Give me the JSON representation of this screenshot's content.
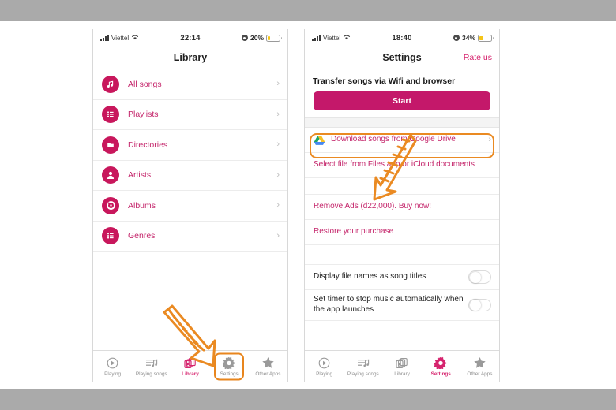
{
  "page": {
    "background_color": "#ffffff",
    "band_color": "#aaaaaa",
    "brand_pink": "#c4186a",
    "link_pink": "#c4246a",
    "accent_orange": "#e8861e",
    "battery_yellow": "#f5c518"
  },
  "annotations": {
    "arrow_left": "hand-drawn-orange-arrow",
    "arrow_right": "hand-drawn-orange-arrow",
    "highlight_settings_tab": "orange-rounded-rect",
    "highlight_start_button": "orange-rounded-rect"
  },
  "phone_left": {
    "status_bar": {
      "carrier": "Viettel",
      "time": "22:14",
      "battery_percent": "20%",
      "battery_level": 20,
      "signal_icon": "signal-bars-icon",
      "wifi_icon": "wifi-icon",
      "location_icon": "location-services-icon",
      "battery_icon": "battery-icon"
    },
    "nav": {
      "title": "Library"
    },
    "list": [
      {
        "label": "All songs",
        "icon": "music-note-icon",
        "chevron": "›"
      },
      {
        "label": "Playlists",
        "icon": "list-icon",
        "chevron": "›"
      },
      {
        "label": "Directories",
        "icon": "folder-icon",
        "chevron": "›"
      },
      {
        "label": "Artists",
        "icon": "person-icon",
        "chevron": "›"
      },
      {
        "label": "Albums",
        "icon": "vinyl-record-icon",
        "chevron": "›"
      },
      {
        "label": "Genres",
        "icon": "list-icon",
        "chevron": "›"
      }
    ],
    "tabs": [
      {
        "label": "Playing",
        "icon": "play-circle-icon",
        "active": false,
        "circled": false
      },
      {
        "label": "Playing songs",
        "icon": "queue-music-icon",
        "active": false,
        "circled": false
      },
      {
        "label": "Library",
        "icon": "library-icon",
        "active": true,
        "circled": false
      },
      {
        "label": "Settings",
        "icon": "gear-icon",
        "active": false,
        "circled": true
      },
      {
        "label": "Other Apps",
        "icon": "star-icon",
        "active": false,
        "circled": false
      }
    ]
  },
  "phone_right": {
    "status_bar": {
      "carrier": "Viettel",
      "time": "18:40",
      "battery_percent": "34%",
      "battery_level": 34,
      "signal_icon": "signal-bars-icon",
      "wifi_icon": "wifi-icon",
      "location_icon": "location-services-icon",
      "battery_icon": "battery-icon"
    },
    "nav": {
      "title": "Settings",
      "action": "Rate us"
    },
    "section_header": "Transfer songs via Wifi and browser",
    "start_button": "Start",
    "rows": [
      {
        "label": "Download songs from Google Drive",
        "icon": "google-drive-icon",
        "chevron": "›",
        "style": "link"
      },
      {
        "label": "Select file from Files app or iCloud documents",
        "icon": null,
        "chevron": "",
        "style": "link"
      },
      {
        "label": "Remove Ads (đ22,000). Buy now!",
        "icon": null,
        "chevron": "",
        "style": "link"
      },
      {
        "label": "Restore your purchase",
        "icon": null,
        "chevron": "",
        "style": "link"
      }
    ],
    "toggles": [
      {
        "label": "Display file names as song titles",
        "value": "off"
      },
      {
        "label": "Set timer to stop music automatically when the app launches",
        "value": "off"
      }
    ],
    "tabs": [
      {
        "label": "Playing",
        "icon": "play-circle-icon",
        "active": false,
        "circled": false
      },
      {
        "label": "Playing songs",
        "icon": "queue-music-icon",
        "active": false,
        "circled": false
      },
      {
        "label": "Library",
        "icon": "library-icon",
        "active": false,
        "circled": false
      },
      {
        "label": "Settings",
        "icon": "gear-icon",
        "active": true,
        "circled": false
      },
      {
        "label": "Other Apps",
        "icon": "star-icon",
        "active": false,
        "circled": false
      }
    ]
  }
}
